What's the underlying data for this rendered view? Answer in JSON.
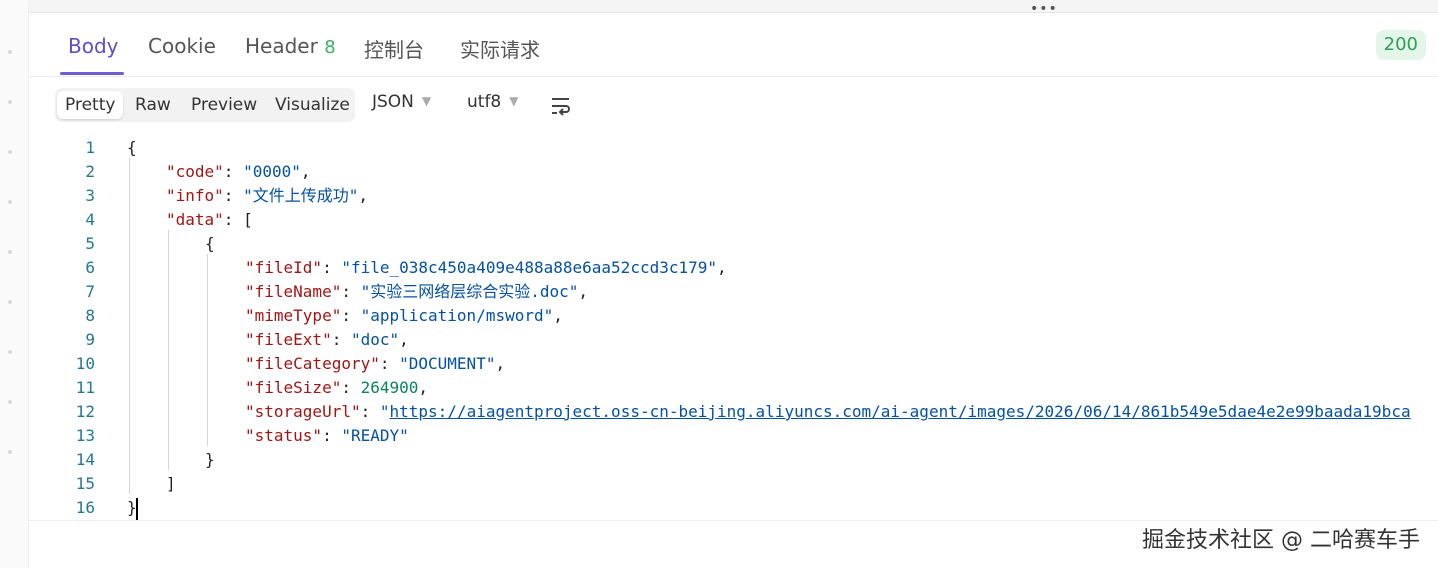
{
  "tabs": [
    {
      "label": "Body"
    },
    {
      "label": "Cookie"
    },
    {
      "label": "Header",
      "count": "8"
    },
    {
      "label": "控制台"
    },
    {
      "label": "实际请求"
    }
  ],
  "status": {
    "code": "200",
    "color": "#2f9e55"
  },
  "view_modes": [
    "Pretty",
    "Raw",
    "Preview",
    "Visualize"
  ],
  "format_select": "JSON",
  "encoding_select": "utf8",
  "icons": {
    "wrap": "wrap-lines-icon",
    "drag": "drag-handle-icon"
  },
  "accent_color": "#6c5fd6",
  "code_lines": [
    {
      "n": "1"
    },
    {
      "n": "2",
      "key": "\"code\"",
      "val": "\"0000\""
    },
    {
      "n": "3",
      "key": "\"info\"",
      "val": "\"文件上传成功\""
    },
    {
      "n": "4",
      "key": "\"data\""
    },
    {
      "n": "5"
    },
    {
      "n": "6",
      "key": "\"fileId\"",
      "val": "\"file_038c450a409e488a88e6aa52ccd3c179\""
    },
    {
      "n": "7",
      "key": "\"fileName\"",
      "val": "\"实验三网络层综合实验.doc\""
    },
    {
      "n": "8",
      "key": "\"mimeType\"",
      "val": "\"application/msword\""
    },
    {
      "n": "9",
      "key": "\"fileExt\"",
      "val": "\"doc\""
    },
    {
      "n": "10",
      "key": "\"fileCategory\"",
      "val": "\"DOCUMENT\""
    },
    {
      "n": "11",
      "key": "\"fileSize\"",
      "val": "264900"
    },
    {
      "n": "12",
      "key": "\"storageUrl\"",
      "val": "https://aiagentproject.oss-cn-beijing.aliyuncs.com/ai-agent/images/2026/06/14/861b549e5dae4e2e99baada19bca"
    },
    {
      "n": "13",
      "key": "\"status\"",
      "val": "\"READY\""
    },
    {
      "n": "14"
    },
    {
      "n": "15"
    },
    {
      "n": "16"
    }
  ],
  "watermark": "掘金技术社区 @ 二哈赛车手"
}
